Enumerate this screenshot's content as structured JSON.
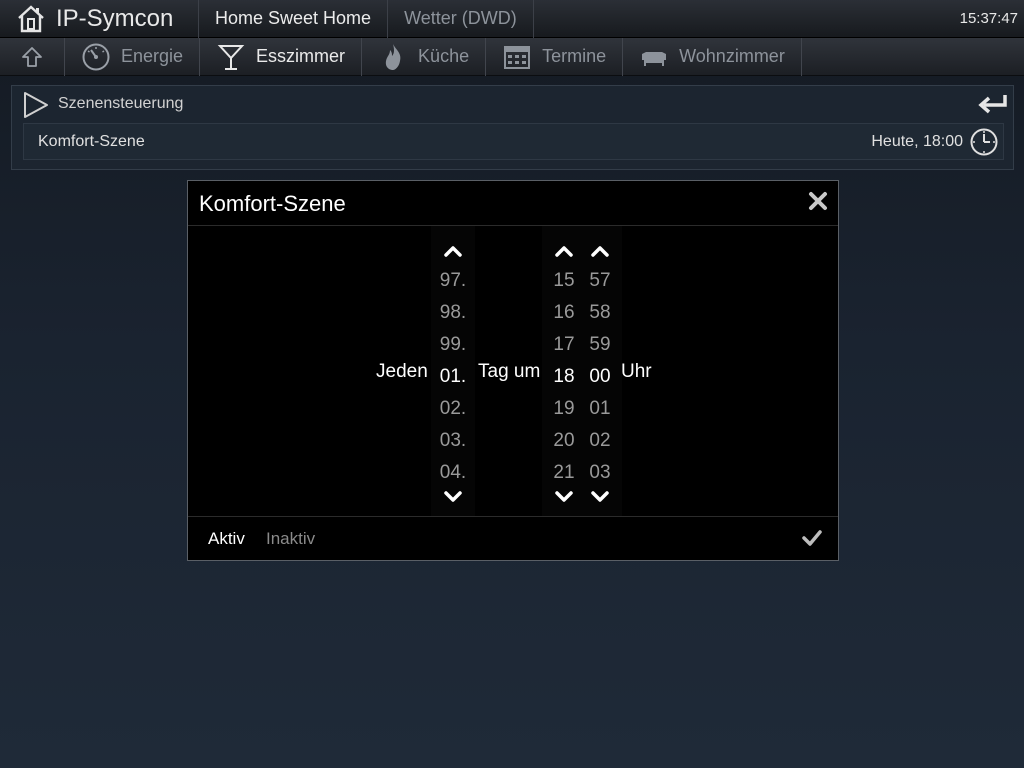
{
  "app": {
    "title": "IP-Symcon",
    "clock": "15:37:47"
  },
  "top_tabs": [
    {
      "label": "Home Sweet Home",
      "active": true
    },
    {
      "label": "Wetter (DWD)",
      "active": false
    }
  ],
  "nav": {
    "up_icon": "arrow-up-icon",
    "items": [
      {
        "label": "Energie",
        "icon": "gauge-icon",
        "active": false
      },
      {
        "label": "Esszimmer",
        "icon": "cocktail-glass-icon",
        "active": true
      },
      {
        "label": "Küche",
        "icon": "flame-icon",
        "active": false
      },
      {
        "label": "Termine",
        "icon": "calendar-icon",
        "active": false
      },
      {
        "label": "Wohnzimmer",
        "icon": "sofa-icon",
        "active": false
      }
    ]
  },
  "panel": {
    "title": "Szenensteuerung",
    "row": {
      "label": "Komfort-Szene",
      "value": "Heute, 18:00"
    }
  },
  "dialog": {
    "title": "Komfort-Szene",
    "prefix": "Jeden",
    "mid_text": "Tag um",
    "suffix": "Uhr",
    "day_values": [
      "97.",
      "98.",
      "99.",
      "01.",
      "02.",
      "03.",
      "04."
    ],
    "hour_values": [
      "15",
      "16",
      "17",
      "18",
      "19",
      "20",
      "21"
    ],
    "minute_values": [
      "57",
      "58",
      "59",
      "00",
      "01",
      "02",
      "03"
    ],
    "selected_day": "01.",
    "selected_hour": "18",
    "selected_minute": "00",
    "status_active": "Aktiv",
    "status_inactive": "Inaktiv"
  },
  "colors": {
    "accent_text": "#ffffff",
    "inactive_text": "#8d939b",
    "dialog_bg": "#000000"
  }
}
